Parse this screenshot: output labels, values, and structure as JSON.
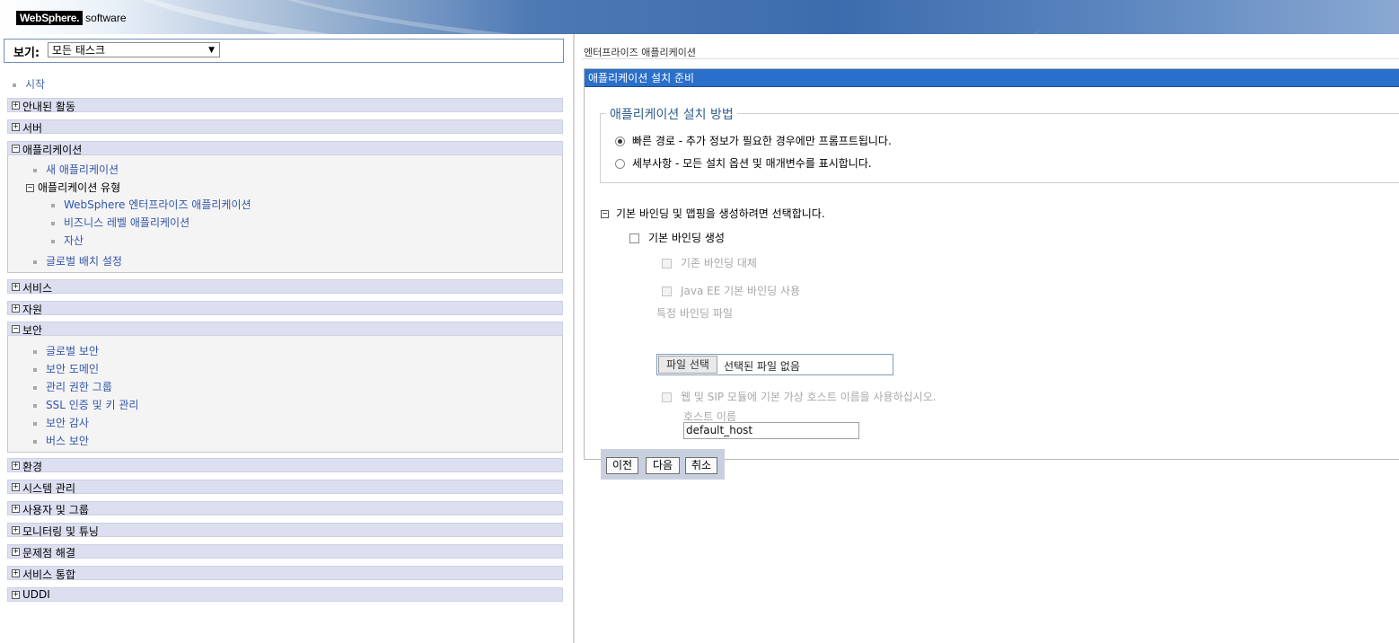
{
  "banner": {
    "brand": "WebSphere.",
    "sub": "software"
  },
  "nav": {
    "view_label": "보기:",
    "view_value": "모든 태스크",
    "start_link": "시작",
    "sections": {
      "guided": "안내된 활동",
      "servers": "서버",
      "applications": "애플리케이션",
      "services": "서비스",
      "resources": "자원",
      "security": "보안",
      "environment": "환경",
      "sysadmin": "시스템 관리",
      "users_groups": "사용자 및 그룹",
      "monitoring": "모니터링 및 튜닝",
      "troubleshooting": "문제점 해결",
      "service_integration": "서비스 통합",
      "uddi": "UDDI"
    },
    "app_items": {
      "new_app": "새 애플리케이션",
      "app_types": "애플리케이션 유형",
      "websphere_ent": "WebSphere 엔터프라이즈 애플리케이션",
      "business_level": "비즈니스 레벨 애플리케이션",
      "assets": "자산",
      "global_deploy": "글로벌 배치 설정"
    },
    "security_items": {
      "global_security": "글로벌 보안",
      "security_domain": "보안 도메인",
      "admin_groups": "관리 권한 그룹",
      "ssl": "SSL 인증 및 키 관리",
      "security_audit": "보안 감사",
      "bus_security": "버스 보안"
    }
  },
  "main": {
    "breadcrumb": "엔터프라이즈 애플리케이션",
    "box_title": "애플리케이션 설치 준비",
    "legend": "애플리케이션 설치 방법",
    "radio_fast": "빠른 경로 - 추가 정보가 필요한 경우에만 프롬프트됩니다.",
    "radio_detail": "세부사항 - 모든 설치 옵션 및 매개변수를 표시합니다.",
    "radio_selected": "fast",
    "binding_section": "기본 바인딩 및 맵핑을 생성하려면 선택합니다.",
    "gen_default_bindings": "기본 바인딩 생성",
    "override_bindings": "기존 바인딩 대체",
    "javaee_bindings": "Java EE 기본 바인딩 사용",
    "specific_file_label": "특정 바인딩 파일",
    "file_button": "파일 선택",
    "file_none": "선택된 파일 없음",
    "virtual_host_opt": "웹 및 SIP 모듈에 기본 가상 호스트 이름을 사용하십시오.",
    "host_label": "호스트 이름",
    "host_value": "default_host",
    "btn_prev": "이전",
    "btn_next": "다음",
    "btn_cancel": "취소"
  },
  "colors": {
    "box_header": "#2a6fc9",
    "section_bg": "#dcdff0",
    "link": "#3355aa"
  }
}
